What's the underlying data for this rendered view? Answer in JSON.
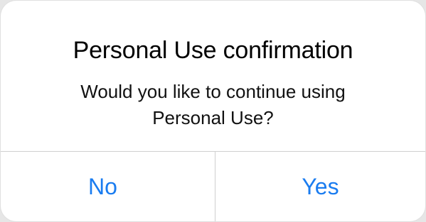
{
  "dialog": {
    "title": "Personal Use confirmation",
    "message": "Would you like to continue using Personal Use?",
    "buttons": {
      "no_label": "No",
      "yes_label": "Yes"
    },
    "colors": {
      "button_text": "#1a7cf0",
      "title_text": "#000000",
      "background": "#ffffff",
      "divider": "#d0d0d0"
    }
  }
}
